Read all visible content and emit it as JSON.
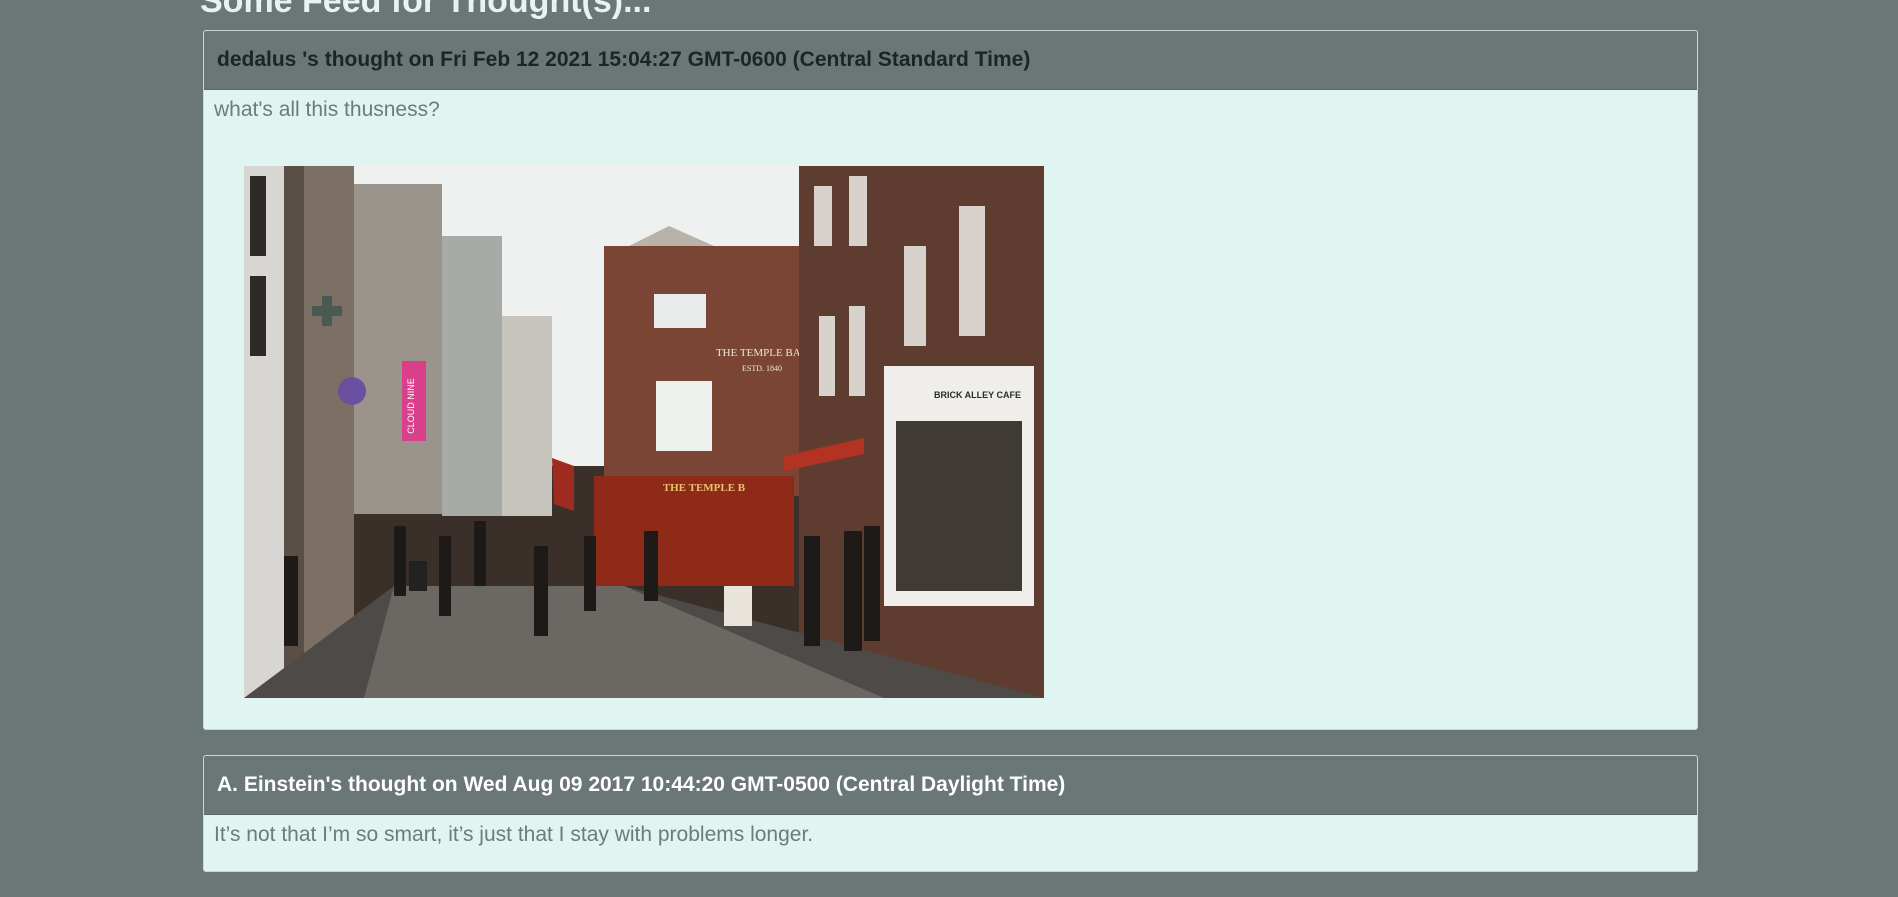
{
  "page": {
    "title": "Some Feed for Thought(s)..."
  },
  "thoughts": [
    {
      "header": "dedalus 's thought on Fri Feb 12 2021 15:04:27 GMT-0600 (Central Standard Time)",
      "body": "what's all this thusness?",
      "image": {
        "subject": "street-photo",
        "signs": [
          "THE TEMPLE BAR",
          "ESTD. 1840",
          "CLOUD NINE",
          "BRICK ALLEY CAFE",
          "THE TEMPLE B"
        ]
      }
    },
    {
      "header": "A. Einstein's thought on Wed Aug 09 2017 10:44:20 GMT-0500 (Central Daylight Time)",
      "body": "It’s not that I’m so smart, it’s just that I stay with problems longer."
    }
  ],
  "colors": {
    "page_background": "#6b7677",
    "card_background": "#e0f4f2",
    "header_background": "#6b7677",
    "body_text": "#6f7a7a"
  }
}
